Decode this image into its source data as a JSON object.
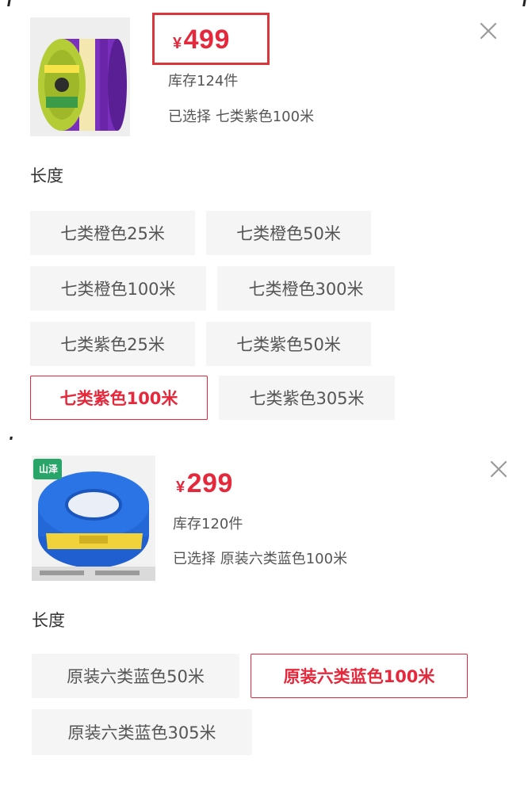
{
  "panel1": {
    "price_symbol": "¥",
    "price_value": "499",
    "stock": "库存124件",
    "selected": "已选择 七类紫色100米",
    "section_title": "长度",
    "options": [
      "七类橙色25米",
      "七类橙色50米",
      "七类橙色100米",
      "七类橙色300米",
      "七类紫色25米",
      "七类紫色50米",
      "七类紫色100米",
      "七类紫色305米"
    ],
    "selected_option_index": 6
  },
  "panel2": {
    "thumb_badge": "山泽",
    "price_symbol": "¥",
    "price_value": "299",
    "stock": "库存120件",
    "selected": "已选择 原装六类蓝色100米",
    "section_title": "长度",
    "options": [
      "原装六类蓝色50米",
      "原装六类蓝色100米",
      "原装六类蓝色305米"
    ],
    "selected_option_index": 1
  },
  "colors": {
    "accent": "#e5283b",
    "option_bg": "#f5f5f5",
    "highlight_box": "#d9363e"
  },
  "icons": {
    "close": "close-icon"
  }
}
